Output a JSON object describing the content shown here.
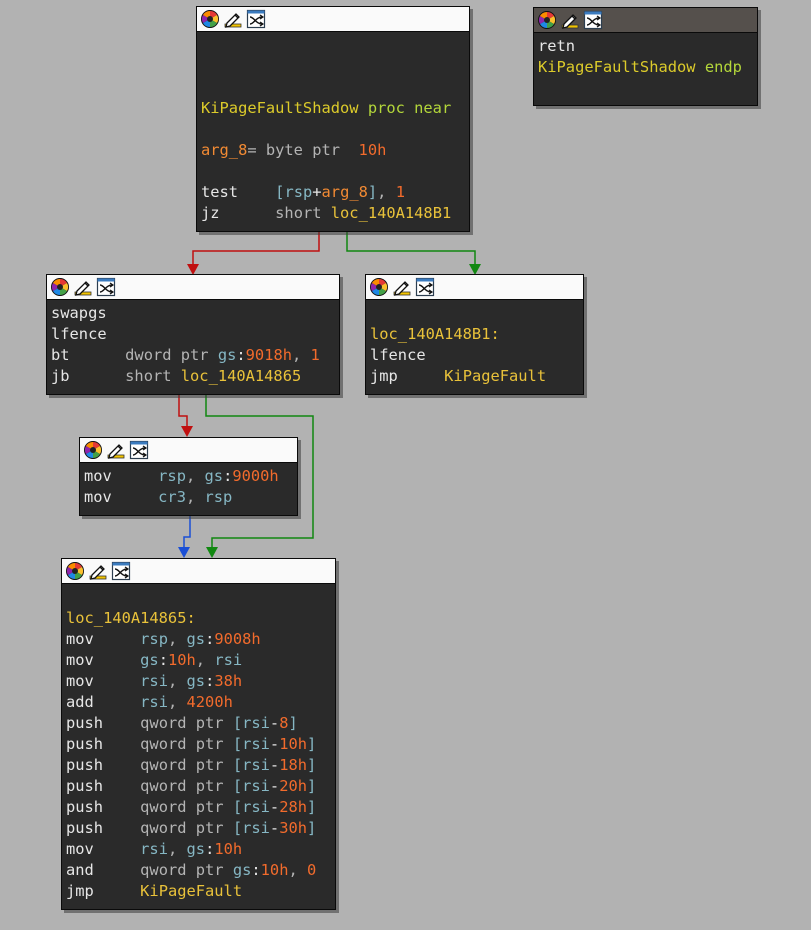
{
  "colors": {
    "background": "#b2b2b2",
    "block_bg": "#2a2a2a",
    "edge_true": "#118811",
    "edge_false": "#c01010",
    "edge_uncond": "#1a4fd6"
  },
  "toolbar_icons": [
    "color-palette-icon",
    "edit-pencil-icon",
    "graph-layout-icon"
  ],
  "blocks": [
    {
      "id": "b1",
      "lines": [
        [],
        [],
        [],
        [
          {
            "t": "KiPageFaultShadow",
            "c": "proc"
          },
          {
            "t": " "
          },
          {
            "t": "proc near",
            "c": "pk"
          }
        ],
        [],
        [
          {
            "t": "arg_8",
            "c": "arg"
          },
          {
            "t": "= byte ptr  ",
            "c": "kw"
          },
          {
            "t": "10h",
            "c": "num"
          }
        ],
        [],
        [
          {
            "t": "test",
            "c": "ins"
          },
          {
            "t": "    "
          },
          {
            "t": "[",
            "c": "reg"
          },
          {
            "t": "rsp",
            "c": "reg"
          },
          {
            "t": "+",
            "c": "p"
          },
          {
            "t": "arg_8",
            "c": "arg"
          },
          {
            "t": "]",
            "c": "reg"
          },
          {
            "t": ", ",
            "c": "kw"
          },
          {
            "t": "1",
            "c": "num"
          }
        ],
        [
          {
            "t": "jz",
            "c": "ins"
          },
          {
            "t": "      "
          },
          {
            "t": "short ",
            "c": "kw"
          },
          {
            "t": "loc_140A148B1",
            "c": "lbl"
          }
        ]
      ]
    },
    {
      "id": "b2",
      "lines": [
        [
          {
            "t": "swapgs",
            "c": "ins"
          }
        ],
        [
          {
            "t": "lfence",
            "c": "ins"
          }
        ],
        [
          {
            "t": "bt",
            "c": "ins"
          },
          {
            "t": "      "
          },
          {
            "t": "dword ptr ",
            "c": "kw"
          },
          {
            "t": "gs",
            "c": "reg"
          },
          {
            "t": ":",
            "c": "p"
          },
          {
            "t": "9018h",
            "c": "num"
          },
          {
            "t": ", ",
            "c": "kw"
          },
          {
            "t": "1",
            "c": "num"
          }
        ],
        [
          {
            "t": "jb",
            "c": "ins"
          },
          {
            "t": "      "
          },
          {
            "t": "short ",
            "c": "kw"
          },
          {
            "t": "loc_140A14865",
            "c": "lbl"
          }
        ]
      ]
    },
    {
      "id": "b3",
      "lines": [
        [],
        [
          {
            "t": "loc_140A148B1:",
            "c": "lbl"
          }
        ],
        [
          {
            "t": "lfence",
            "c": "ins"
          }
        ],
        [
          {
            "t": "jmp",
            "c": "ins"
          },
          {
            "t": "     "
          },
          {
            "t": "KiPageFault",
            "c": "lbl"
          }
        ]
      ]
    },
    {
      "id": "b4",
      "lines": [
        [
          {
            "t": "mov",
            "c": "ins"
          },
          {
            "t": "     "
          },
          {
            "t": "rsp",
            "c": "reg"
          },
          {
            "t": ", ",
            "c": "kw"
          },
          {
            "t": "gs",
            "c": "reg"
          },
          {
            "t": ":",
            "c": "p"
          },
          {
            "t": "9000h",
            "c": "num"
          }
        ],
        [
          {
            "t": "mov",
            "c": "ins"
          },
          {
            "t": "     "
          },
          {
            "t": "cr3",
            "c": "reg"
          },
          {
            "t": ", ",
            "c": "kw"
          },
          {
            "t": "rsp",
            "c": "reg"
          }
        ]
      ]
    },
    {
      "id": "b5",
      "lines": [
        [],
        [
          {
            "t": "loc_140A14865:",
            "c": "lbl"
          }
        ],
        [
          {
            "t": "mov",
            "c": "ins"
          },
          {
            "t": "     "
          },
          {
            "t": "rsp",
            "c": "reg"
          },
          {
            "t": ", ",
            "c": "kw"
          },
          {
            "t": "gs",
            "c": "reg"
          },
          {
            "t": ":",
            "c": "p"
          },
          {
            "t": "9008h",
            "c": "num"
          }
        ],
        [
          {
            "t": "mov",
            "c": "ins"
          },
          {
            "t": "     "
          },
          {
            "t": "gs",
            "c": "reg"
          },
          {
            "t": ":",
            "c": "p"
          },
          {
            "t": "10h",
            "c": "num"
          },
          {
            "t": ", ",
            "c": "kw"
          },
          {
            "t": "rsi",
            "c": "reg"
          }
        ],
        [
          {
            "t": "mov",
            "c": "ins"
          },
          {
            "t": "     "
          },
          {
            "t": "rsi",
            "c": "reg"
          },
          {
            "t": ", ",
            "c": "kw"
          },
          {
            "t": "gs",
            "c": "reg"
          },
          {
            "t": ":",
            "c": "p"
          },
          {
            "t": "38h",
            "c": "num"
          }
        ],
        [
          {
            "t": "add",
            "c": "ins"
          },
          {
            "t": "     "
          },
          {
            "t": "rsi",
            "c": "reg"
          },
          {
            "t": ", ",
            "c": "kw"
          },
          {
            "t": "4200h",
            "c": "num"
          }
        ],
        [
          {
            "t": "push",
            "c": "ins"
          },
          {
            "t": "    "
          },
          {
            "t": "qword ptr ",
            "c": "kw"
          },
          {
            "t": "[",
            "c": "reg"
          },
          {
            "t": "rsi",
            "c": "reg"
          },
          {
            "t": "-",
            "c": "p"
          },
          {
            "t": "8",
            "c": "num"
          },
          {
            "t": "]",
            "c": "reg"
          }
        ],
        [
          {
            "t": "push",
            "c": "ins"
          },
          {
            "t": "    "
          },
          {
            "t": "qword ptr ",
            "c": "kw"
          },
          {
            "t": "[",
            "c": "reg"
          },
          {
            "t": "rsi",
            "c": "reg"
          },
          {
            "t": "-",
            "c": "p"
          },
          {
            "t": "10h",
            "c": "num"
          },
          {
            "t": "]",
            "c": "reg"
          }
        ],
        [
          {
            "t": "push",
            "c": "ins"
          },
          {
            "t": "    "
          },
          {
            "t": "qword ptr ",
            "c": "kw"
          },
          {
            "t": "[",
            "c": "reg"
          },
          {
            "t": "rsi",
            "c": "reg"
          },
          {
            "t": "-",
            "c": "p"
          },
          {
            "t": "18h",
            "c": "num"
          },
          {
            "t": "]",
            "c": "reg"
          }
        ],
        [
          {
            "t": "push",
            "c": "ins"
          },
          {
            "t": "    "
          },
          {
            "t": "qword ptr ",
            "c": "kw"
          },
          {
            "t": "[",
            "c": "reg"
          },
          {
            "t": "rsi",
            "c": "reg"
          },
          {
            "t": "-",
            "c": "p"
          },
          {
            "t": "20h",
            "c": "num"
          },
          {
            "t": "]",
            "c": "reg"
          }
        ],
        [
          {
            "t": "push",
            "c": "ins"
          },
          {
            "t": "    "
          },
          {
            "t": "qword ptr ",
            "c": "kw"
          },
          {
            "t": "[",
            "c": "reg"
          },
          {
            "t": "rsi",
            "c": "reg"
          },
          {
            "t": "-",
            "c": "p"
          },
          {
            "t": "28h",
            "c": "num"
          },
          {
            "t": "]",
            "c": "reg"
          }
        ],
        [
          {
            "t": "push",
            "c": "ins"
          },
          {
            "t": "    "
          },
          {
            "t": "qword ptr ",
            "c": "kw"
          },
          {
            "t": "[",
            "c": "reg"
          },
          {
            "t": "rsi",
            "c": "reg"
          },
          {
            "t": "-",
            "c": "p"
          },
          {
            "t": "30h",
            "c": "num"
          },
          {
            "t": "]",
            "c": "reg"
          }
        ],
        [
          {
            "t": "mov",
            "c": "ins"
          },
          {
            "t": "     "
          },
          {
            "t": "rsi",
            "c": "reg"
          },
          {
            "t": ", ",
            "c": "kw"
          },
          {
            "t": "gs",
            "c": "reg"
          },
          {
            "t": ":",
            "c": "p"
          },
          {
            "t": "10h",
            "c": "num"
          }
        ],
        [
          {
            "t": "and",
            "c": "ins"
          },
          {
            "t": "     "
          },
          {
            "t": "qword ptr ",
            "c": "kw"
          },
          {
            "t": "gs",
            "c": "reg"
          },
          {
            "t": ":",
            "c": "p"
          },
          {
            "t": "10h",
            "c": "num"
          },
          {
            "t": ", ",
            "c": "kw"
          },
          {
            "t": "0",
            "c": "num"
          }
        ],
        [
          {
            "t": "jmp",
            "c": "ins"
          },
          {
            "t": "     "
          },
          {
            "t": "KiPageFault",
            "c": "lbl"
          }
        ]
      ]
    },
    {
      "id": "b6",
      "lines": [
        [
          {
            "t": "retn",
            "c": "ins"
          }
        ],
        [
          {
            "t": "KiPageFaultShadow",
            "c": "proc"
          },
          {
            "t": " "
          },
          {
            "t": "endp",
            "c": "pk"
          }
        ]
      ]
    }
  ]
}
